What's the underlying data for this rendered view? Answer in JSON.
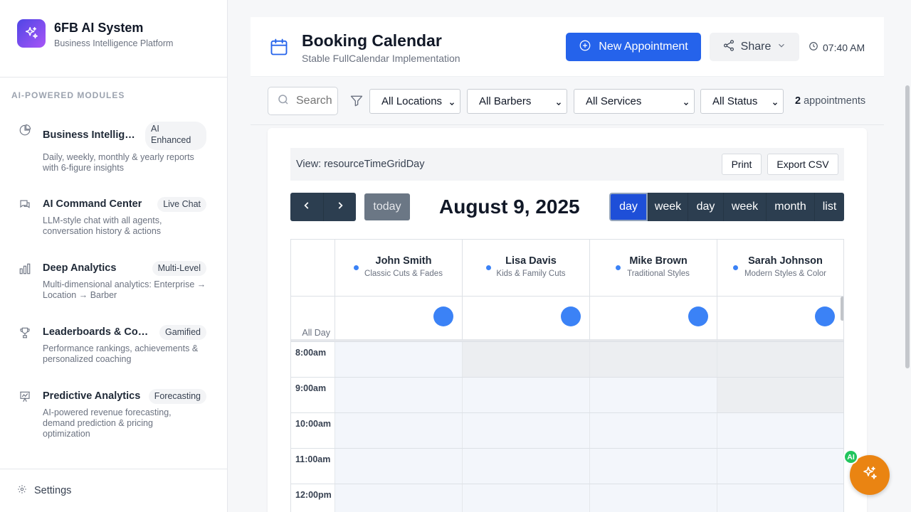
{
  "sidebar": {
    "brand_title": "6FB AI System",
    "brand_subtitle": "Business Intelligence Platform",
    "section_label": "AI-POWERED MODULES",
    "modules": [
      {
        "name": "Business Intelligen…",
        "badge_line1": "AI",
        "badge_line2": "Enhanced",
        "desc": "Daily, weekly, monthly & yearly reports with 6-figure insights",
        "icon": "pie-chart-icon"
      },
      {
        "name": "AI Command Center",
        "badge": "Live Chat",
        "desc": "LLM-style chat with all agents, conversation history & actions",
        "icon": "chat-icon"
      },
      {
        "name": "Deep Analytics",
        "badge": "Multi-Level",
        "desc": "Multi-dimensional analytics: Enterprise → Location → Barber",
        "icon": "bar-chart-icon"
      },
      {
        "name": "Leaderboards & Coac…",
        "badge": "Gamified",
        "desc": "Performance rankings, achievements & personalized coaching",
        "icon": "trophy-icon"
      },
      {
        "name": "Predictive Analytics",
        "badge": "Forecasting",
        "desc": "AI-powered revenue forecasting, demand prediction & pricing optimization",
        "icon": "presentation-chart-icon"
      }
    ],
    "settings_label": "Settings"
  },
  "header": {
    "title": "Booking Calendar",
    "subtitle": "Stable FullCalendar Implementation",
    "new_appointment": "New Appointment",
    "share": "Share",
    "time": "07:40 AM"
  },
  "filters": {
    "search_placeholder": "Search",
    "location": "All Locations",
    "barber": "All Barbers",
    "service": "All Services",
    "status": "All Status",
    "count": "2",
    "count_label": "appointments"
  },
  "calendar": {
    "view_label": "View: resourceTimeGridDay",
    "print": "Print",
    "export_csv": "Export CSV",
    "today": "today",
    "date_title": "August 9, 2025",
    "view_buttons": [
      "day",
      "week",
      "day",
      "week",
      "month",
      "list"
    ],
    "active_view": "day",
    "all_day_label": "All Day",
    "resources": [
      {
        "name": "John Smith",
        "specialty": "Classic Cuts & Fades"
      },
      {
        "name": "Lisa Davis",
        "specialty": "Kids & Family Cuts"
      },
      {
        "name": "Mike Brown",
        "specialty": "Traditional Styles"
      },
      {
        "name": "Sarah Johnson",
        "specialty": "Modern Styles & Color"
      }
    ],
    "time_slots": [
      "8:00am",
      "9:00am",
      "10:00am",
      "11:00am",
      "12:00pm"
    ]
  },
  "fab": {
    "badge": "AI"
  },
  "colors": {
    "primary": "#2563eb",
    "toolbar": "#2c3e50",
    "fab": "#ea8412",
    "brand_gradient_start": "#4f46e5",
    "brand_gradient_end": "#a855f7"
  }
}
